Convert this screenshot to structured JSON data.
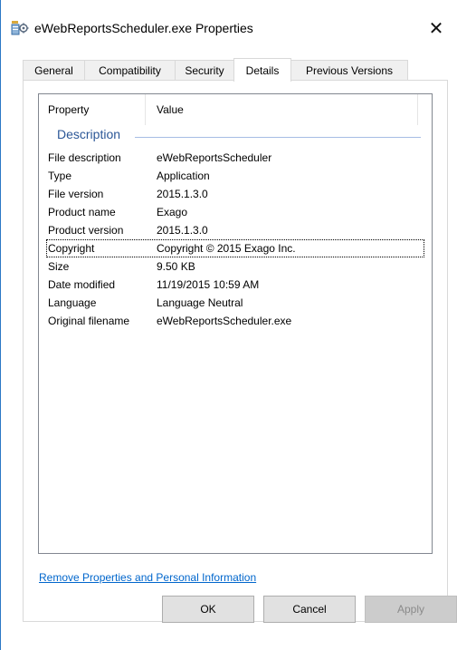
{
  "window": {
    "title": "eWebReportsScheduler.exe Properties",
    "close_glyph": "✕",
    "accent_color": "#2b78c5"
  },
  "tabs": [
    {
      "label": "General"
    },
    {
      "label": "Compatibility"
    },
    {
      "label": "Security"
    },
    {
      "label": "Details"
    },
    {
      "label": "Previous Versions"
    }
  ],
  "active_tab": "Details",
  "details": {
    "columns": {
      "property": "Property",
      "value": "Value"
    },
    "group": "Description",
    "rows": [
      {
        "property": "File description",
        "value": "eWebReportsScheduler"
      },
      {
        "property": "Type",
        "value": "Application"
      },
      {
        "property": "File version",
        "value": "2015.1.3.0"
      },
      {
        "property": "Product name",
        "value": "Exago"
      },
      {
        "property": "Product version",
        "value": "2015.1.3.0"
      },
      {
        "property": "Copyright",
        "value": "Copyright © 2015 Exago Inc."
      },
      {
        "property": "Size",
        "value": "9.50 KB"
      },
      {
        "property": "Date modified",
        "value": "11/19/2015 10:59 AM"
      },
      {
        "property": "Language",
        "value": "Language Neutral"
      },
      {
        "property": "Original filename",
        "value": "eWebReportsScheduler.exe"
      }
    ]
  },
  "link": {
    "label": "Remove Properties and Personal Information"
  },
  "buttons": {
    "ok": "OK",
    "cancel": "Cancel",
    "apply": "Apply"
  }
}
